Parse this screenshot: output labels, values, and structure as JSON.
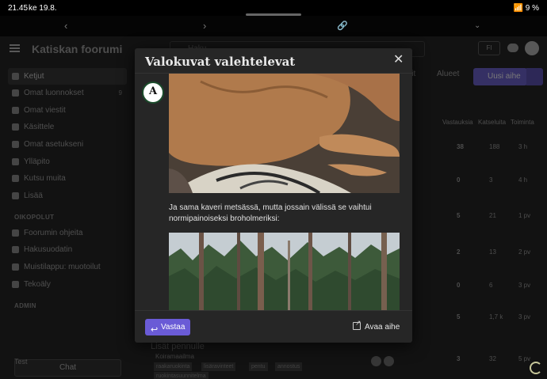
{
  "status": {
    "time": "21.45",
    "date": "ke 19.8.",
    "right": "📶 9 %"
  },
  "header": {
    "title": "Katiskan foorumi",
    "search_placeholder": "Haku",
    "lang": "FI"
  },
  "sidebar": {
    "items": [
      {
        "label": "Ketjut",
        "top": 0,
        "active": true
      },
      {
        "label": "Omat luonnokset",
        "count": "9"
      },
      {
        "label": "Omat viestit"
      },
      {
        "label": "Käsittele"
      },
      {
        "label": "Omat asetukseni"
      },
      {
        "label": "Ylläpito"
      },
      {
        "label": "Kutsu muita"
      },
      {
        "label": "Lisää"
      }
    ],
    "section1": "OIKOPOLUT",
    "shortcuts": [
      {
        "label": "Foorumin ohjeita"
      },
      {
        "label": "Hakusuodatin"
      },
      {
        "label": "Muistilappu: muotoilut"
      },
      {
        "label": "Tekoäly"
      }
    ],
    "section2": "ADMIN",
    "chat": "Chat",
    "footer": "Test"
  },
  "topnav": {
    "link1": "rkit",
    "link2": "Alueet",
    "new_topic": "Uusi aihe"
  },
  "columns": [
    "Vastauksia",
    "Katseluita",
    "Toiminta"
  ],
  "rows": [
    {
      "r": "38",
      "v": "188",
      "a": "3 h"
    },
    {
      "r": "0",
      "v": "3",
      "a": "4 h"
    },
    {
      "r": "5",
      "v": "21",
      "a": "1 pv"
    },
    {
      "r": "2",
      "v": "13",
      "a": "2 pv"
    },
    {
      "r": "0",
      "v": "6",
      "a": "3 pv"
    },
    {
      "r": "5",
      "v": "1,7 k",
      "a": "3 pv"
    },
    {
      "r": "3",
      "v": "32",
      "a": "5 pv"
    }
  ],
  "bottom_topic": {
    "title": "Lisät pennulle",
    "category": "Koiramaailma",
    "tags": [
      "raakaruokinta",
      "lisäravinteet",
      "pentu",
      "annostus",
      "ruokintasuunnitelma"
    ]
  },
  "modal": {
    "title": "Valokuvat valehtelevat",
    "poster_initial": "A",
    "text": "Ja sama kaveri metsässä, mutta jossain välissä se vaihtui normipainoiseksi broholmeriksi:",
    "reply": "Vastaa",
    "open_topic": "Avaa aihe"
  }
}
